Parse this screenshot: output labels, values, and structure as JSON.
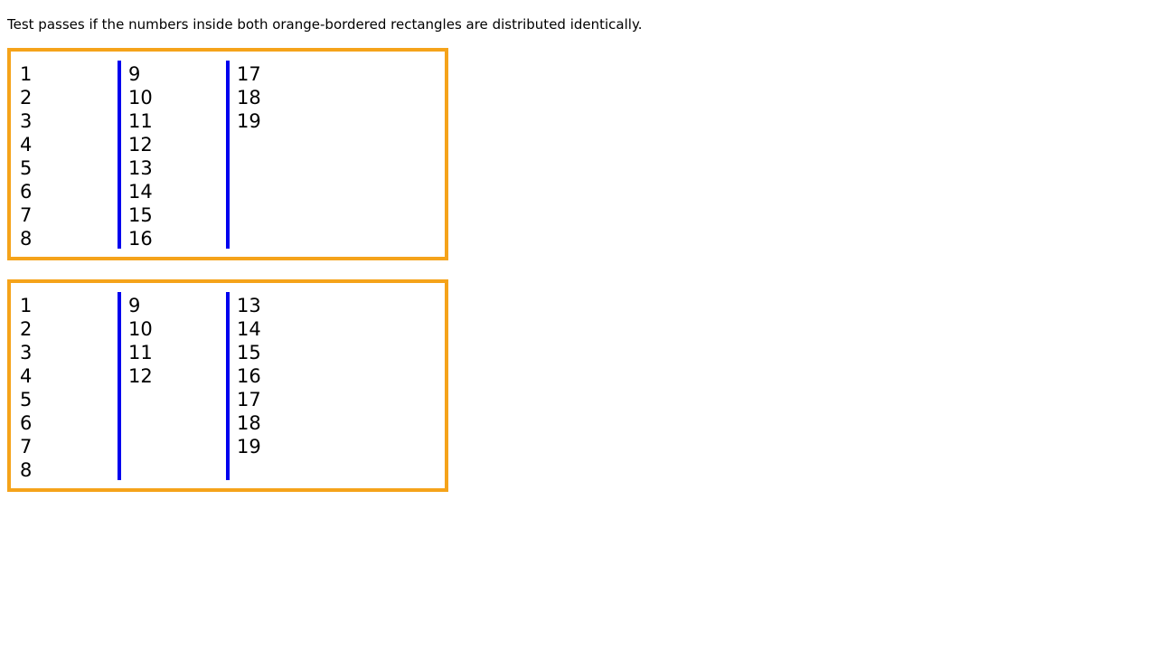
{
  "instruction": {
    "prefix": "Test passes if the numbers inside both orange-bordered rectangles are ",
    "emphasis": "distributed identically",
    "suffix": "."
  },
  "colors": {
    "box_border": "#f5a31a",
    "column_rule": "#0000ee",
    "text": "#000000"
  },
  "boxes": [
    {
      "columns": [
        [
          "1",
          "2",
          "3",
          "4",
          "5",
          "6",
          "7",
          "8"
        ],
        [
          "9",
          "10",
          "11",
          "12",
          "13",
          "14",
          "15",
          "16"
        ],
        [
          "17",
          "18",
          "19"
        ]
      ]
    },
    {
      "columns": [
        [
          "1",
          "2",
          "3",
          "4",
          "5",
          "6",
          "7",
          "8"
        ],
        [
          "9",
          "10",
          "11",
          "12"
        ],
        [
          "13",
          "14",
          "15",
          "16",
          "17",
          "18",
          "19"
        ]
      ]
    }
  ]
}
